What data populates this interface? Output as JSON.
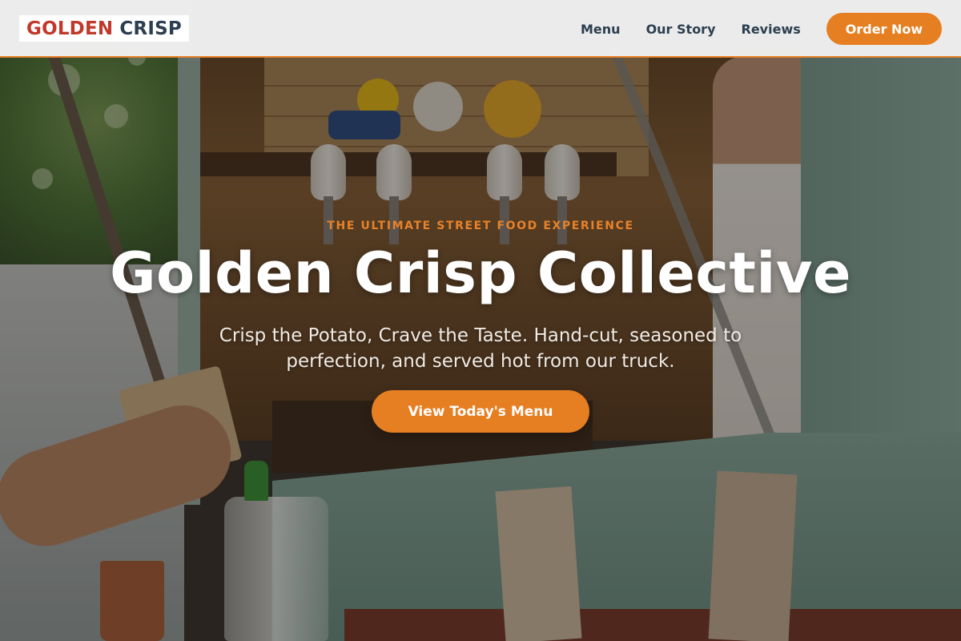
{
  "brand": {
    "logo_part1": "GOLDEN",
    "logo_part2": "CRISP",
    "color_primary": "#c0392b",
    "color_secondary": "#2c3e50",
    "accent": "#e67e22"
  },
  "nav": {
    "items": [
      {
        "label": "Menu"
      },
      {
        "label": "Our Story"
      },
      {
        "label": "Reviews"
      }
    ],
    "order_button": "Order Now"
  },
  "hero": {
    "eyebrow": "THE ULTIMATE STREET FOOD EXPERIENCE",
    "title": "Golden Crisp Collective",
    "subtitle": "Crisp the Potato, Crave the Taste. Hand-cut, seasoned to perfection, and served hot from our truck.",
    "cta_label": "View Today's Menu",
    "background": "food-truck-photo"
  }
}
